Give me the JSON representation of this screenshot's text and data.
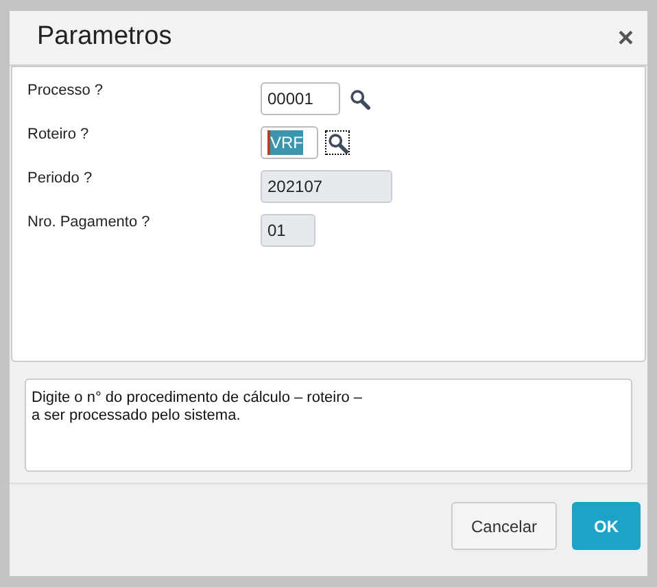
{
  "dialog": {
    "title": "Parametros",
    "close": "×"
  },
  "fields": [
    {
      "label": "Processo ?",
      "value": "00001",
      "disabled": false,
      "lookup": true,
      "lookup_focused": false,
      "text_selected": false
    },
    {
      "label": "Roteiro ?",
      "value": "VRF",
      "disabled": false,
      "lookup": true,
      "lookup_focused": true,
      "text_selected": true
    },
    {
      "label": "Periodo ?",
      "value": "202107",
      "disabled": true,
      "lookup": false,
      "text_selected": false
    },
    {
      "label": "Nro. Pagamento ?",
      "value": "01",
      "disabled": true,
      "lookup": false,
      "text_selected": false
    }
  ],
  "help": {
    "lines": [
      "Digite o n° do procedimento de cálculo – roteiro –",
      "a ser processado pelo sistema."
    ]
  },
  "buttons": [
    {
      "label": "Cancelar",
      "kind": "secondary"
    },
    {
      "label": "OK",
      "kind": "primary"
    }
  ]
}
